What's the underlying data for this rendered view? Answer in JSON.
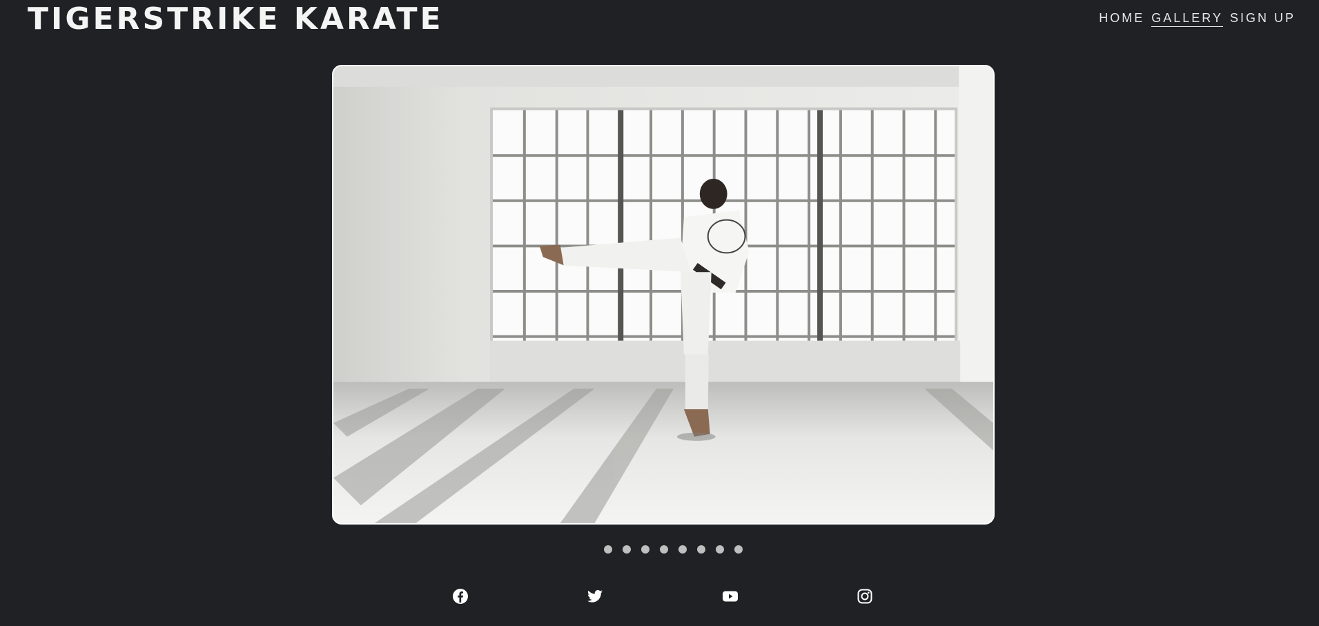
{
  "header": {
    "brand": "TIGERSTRIKE KARATE",
    "nav": [
      {
        "label": "HOME",
        "active": false
      },
      {
        "label": "GALLERY",
        "active": true
      },
      {
        "label": "SIGN UP",
        "active": false
      }
    ]
  },
  "carousel": {
    "slide_count": 8,
    "active_index": 0
  },
  "social": {
    "icons": [
      "facebook-icon",
      "twitter-icon",
      "youtube-icon",
      "instagram-icon"
    ]
  },
  "colors": {
    "background": "#202124",
    "text": "#ffffff",
    "dot": "#bfbfbf"
  }
}
